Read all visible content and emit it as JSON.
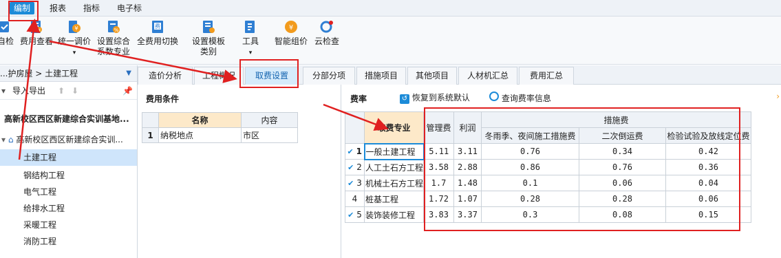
{
  "menu": [
    {
      "label": "编制",
      "active": true
    },
    {
      "label": "报表"
    },
    {
      "label": "指标"
    },
    {
      "label": "电子标"
    }
  ],
  "toolbar": [
    {
      "label": "自检",
      "icon": "self-check-icon"
    },
    {
      "label": "费用查看",
      "icon": "cost-view-icon"
    },
    {
      "label": "统一调价",
      "sub": "▾",
      "icon": "price-adjust-icon"
    },
    {
      "label": "设置综合",
      "label2": "系数专业",
      "icon": "coefficient-icon"
    },
    {
      "label": "全费用切换",
      "icon": "full-cost-switch-icon"
    },
    {
      "label": "设置模板",
      "label2": "类别",
      "icon": "template-category-icon"
    },
    {
      "label": "工具",
      "sub": "▾",
      "icon": "tools-icon"
    },
    {
      "label": "智能组价",
      "icon": "smart-pricing-icon"
    },
    {
      "label": "云检查",
      "icon": "cloud-check-icon"
    }
  ],
  "left": {
    "breadcrumb": "...护房屋 > 土建工程",
    "import_export": "导入导出",
    "tree": [
      {
        "label": "高新校区西区新建综合实训基地...",
        "bold": true
      },
      {
        "label": "高新校区西区新建综合实训...",
        "bold": false,
        "home": true
      },
      {
        "label": "土建工程",
        "selected": true
      },
      {
        "label": "钢结构工程"
      },
      {
        "label": "电气工程"
      },
      {
        "label": "给排水工程"
      },
      {
        "label": "采暖工程"
      },
      {
        "label": "消防工程"
      }
    ]
  },
  "tabs": [
    "造价分析",
    "工程概况",
    "取费设置",
    "分部分项",
    "措施项目",
    "其他项目",
    "人材机汇总",
    "费用汇总"
  ],
  "active_tab": "取费设置",
  "conditions": {
    "title": "费用条件",
    "headers": [
      "名称",
      "内容"
    ],
    "rows": [
      {
        "no": "1",
        "name": "纳税地点",
        "value": "市区"
      }
    ]
  },
  "rates": {
    "title": "费率",
    "restore_label": "恢复到系统默认",
    "query_label": "查询费率信息",
    "headers": {
      "specialty": "取费专业",
      "management": "管理费",
      "profit": "利润",
      "measures": "措施费",
      "winter": "冬雨季、夜间施工措施费",
      "secondary": "二次倒运费",
      "inspection": "检验试验及放线定位费"
    },
    "rows": [
      {
        "no": "1",
        "checked": true,
        "name": "一般土建工程",
        "mgmt": "5.11",
        "profit": "3.11",
        "winter": "0.76",
        "secondary": "0.34",
        "inspection": "0.42"
      },
      {
        "no": "2",
        "checked": true,
        "name": "人工土石方工程",
        "mgmt": "3.58",
        "profit": "2.88",
        "winter": "0.86",
        "secondary": "0.76",
        "inspection": "0.36"
      },
      {
        "no": "3",
        "checked": true,
        "name": "机械土石方工程",
        "mgmt": "1.7",
        "profit": "1.48",
        "winter": "0.1",
        "secondary": "0.06",
        "inspection": "0.04"
      },
      {
        "no": "4",
        "checked": false,
        "name": "桩基工程",
        "mgmt": "1.72",
        "profit": "1.07",
        "winter": "0.28",
        "secondary": "0.28",
        "inspection": "0.06"
      },
      {
        "no": "5",
        "checked": true,
        "name": "装饰装修工程",
        "mgmt": "3.83",
        "profit": "3.37",
        "winter": "0.3",
        "secondary": "0.08",
        "inspection": "0.15"
      }
    ]
  },
  "colors": {
    "accent": "#1c8bd8",
    "annotation": "#e02020",
    "header_highlight": "#fde9c9"
  }
}
